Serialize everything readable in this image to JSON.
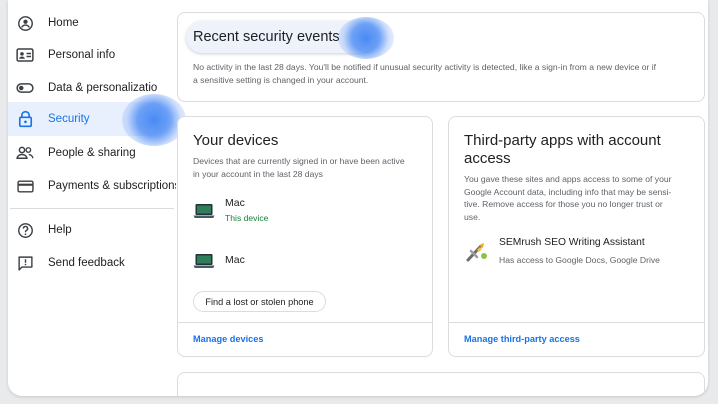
{
  "sidebar": {
    "items": [
      {
        "label": "Home",
        "icon": "home-icon"
      },
      {
        "label": "Personal info",
        "icon": "id-card-icon"
      },
      {
        "label": "Data & personalizatio",
        "icon": "toggle-icon"
      },
      {
        "label": "Security",
        "icon": "lock-icon"
      },
      {
        "label": "People & sharing",
        "icon": "people-icon"
      },
      {
        "label": "Payments & subscriptions",
        "icon": "credit-card-icon"
      },
      {
        "label": "Help",
        "icon": "help-icon"
      },
      {
        "label": "Send feedback",
        "icon": "feedback-icon"
      }
    ],
    "active_index": 3
  },
  "recent_events": {
    "title": "Recent security events",
    "description_line1": "No activity in the last 28 days. You'll be notified if unusual security activity is detected, like a sign-in from a new device or if",
    "description_line2": "a sensitive setting is changed in your account."
  },
  "devices": {
    "title": "Your devices",
    "description_line1": "Devices that are currently signed in or have been active",
    "description_line2": "in your account in the last 28 days",
    "list": [
      {
        "name": "Mac",
        "sub": "This device",
        "icon": "laptop-icon"
      },
      {
        "name": "Mac",
        "sub": "",
        "icon": "laptop-icon"
      }
    ],
    "find_button": "Find a lost or stolen phone",
    "manage_link": "Manage devices"
  },
  "third_party": {
    "title_line1": "Third-party apps with account",
    "title_line2": "access",
    "description_lines": [
      "You gave these sites and apps access to some of your",
      "Google Account data, including info that may be sensi-",
      "tive. Remove access for those you no longer trust or",
      "use."
    ],
    "app": {
      "name": "SEMrush SEO Writing Assistant",
      "access": "Has access to Google Docs, Google Drive",
      "icon": "semrush-app-icon"
    },
    "manage_link": "Manage third-party access"
  },
  "colors": {
    "accent": "#1a73e8",
    "active_bg": "#e8f0fe",
    "this_device": "#188038",
    "glow": "#4285f4"
  }
}
